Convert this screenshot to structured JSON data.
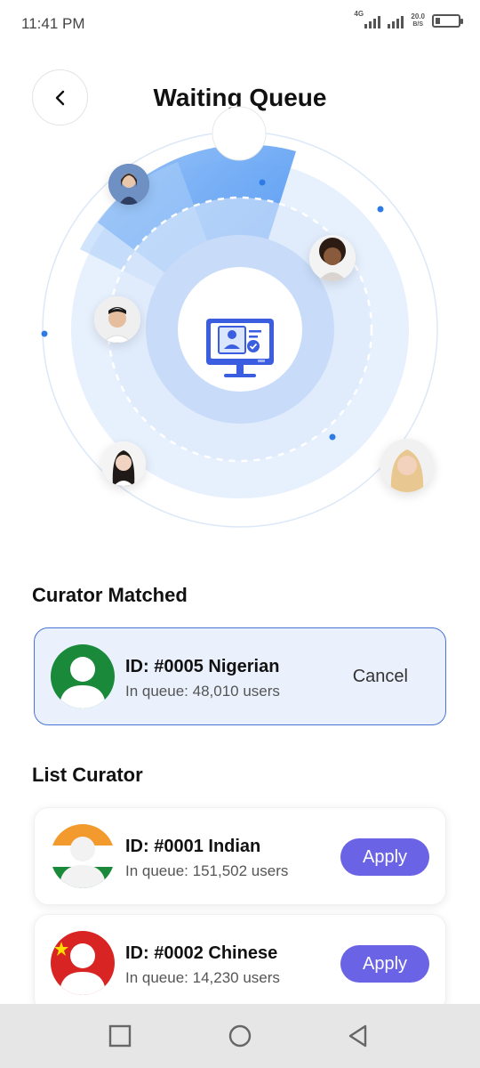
{
  "status_bar": {
    "time": "11:41 PM",
    "network_type": "4G",
    "data_rate_value": "20.0",
    "data_rate_unit": "B/S"
  },
  "header": {
    "title": "Waiting Queue",
    "back_icon": "chevron-left-icon"
  },
  "radar": {
    "center_icon": "monitor-id-verify-icon",
    "accent_color": "#3d8bf2"
  },
  "matched": {
    "section_title": "Curator Matched",
    "curator": {
      "id": "ID: #0005 Nigerian",
      "queue": "In queue: 48,010 users",
      "action": "Cancel"
    }
  },
  "list": {
    "section_title": "List Curator",
    "curators": [
      {
        "id": "ID: #0001 Indian",
        "queue": "In queue: 151,502 users",
        "action": "Apply"
      },
      {
        "id": "ID: #0002 Chinese",
        "queue": "In queue: 14,230 users",
        "action": "Apply"
      }
    ]
  },
  "colors": {
    "primary_button": "#6a63e6",
    "matched_border": "#4a73d6",
    "matched_bg": "#eaf1fd"
  },
  "nav_bar": {
    "buttons": [
      "recents-square-icon",
      "home-circle-icon",
      "back-triangle-icon"
    ]
  }
}
